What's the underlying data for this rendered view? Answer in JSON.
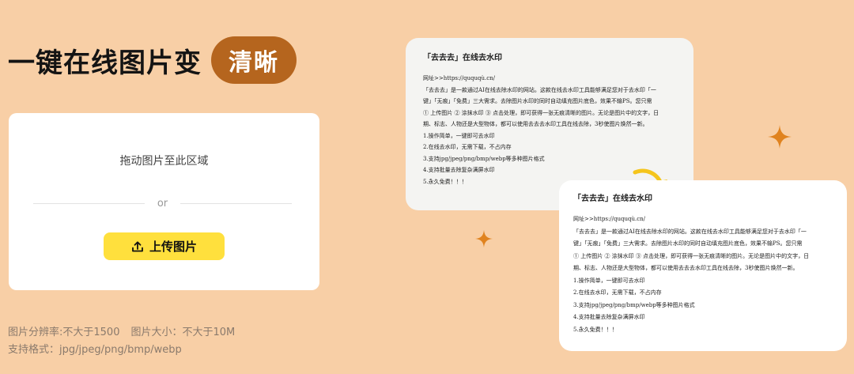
{
  "headline": {
    "main": "一键在线图片变",
    "highlight": "清晰"
  },
  "upload": {
    "drag_text": "拖动图片至此区域",
    "or_text": "or",
    "button_label": "上传图片"
  },
  "info": {
    "resolution": "图片分辨率:不大于1500",
    "size": "图片大小：不大于10M",
    "formats": "支持格式：jpg/jpeg/png/bmp/webp"
  },
  "sample_doc": {
    "title": "「去去去」在线去水印",
    "lines": [
      "网址>>https://ququqù.cn/",
      "「去去去」是一款通过AI在线去除水印的网站。这款在线去水印工具能够满足您对于去水印「一",
      "键」「无痕」「免费」三大需求。去除图片水印的同时自动填充图片底色，效果不输PS。您只需",
      "① 上传图片 ② 涂抹水印 ③ 点击处理，即可获得一张无痕清晰的图片。无论是图片中的文字，日",
      "期、标志、人物还是大型物体，都可以使用去去去水印工具在线去除，3秒使图片焕然一新。",
      "1.操作简单，一键即可去水印",
      "2.在线去水印，无需下载，不占内存",
      "3.支持jpg/jpeg/png/bmp/webp等多种图片格式",
      "4.支持批量去除复杂满屏水印",
      "5.永久免费！！！"
    ]
  },
  "icons": {
    "upload": "upload-icon",
    "sparkle": "sparkle-icon",
    "arrow": "curved-arrow-icon"
  },
  "colors": {
    "background": "#f8cfa6",
    "accent": "#b5651e",
    "button": "#ffe03d"
  }
}
